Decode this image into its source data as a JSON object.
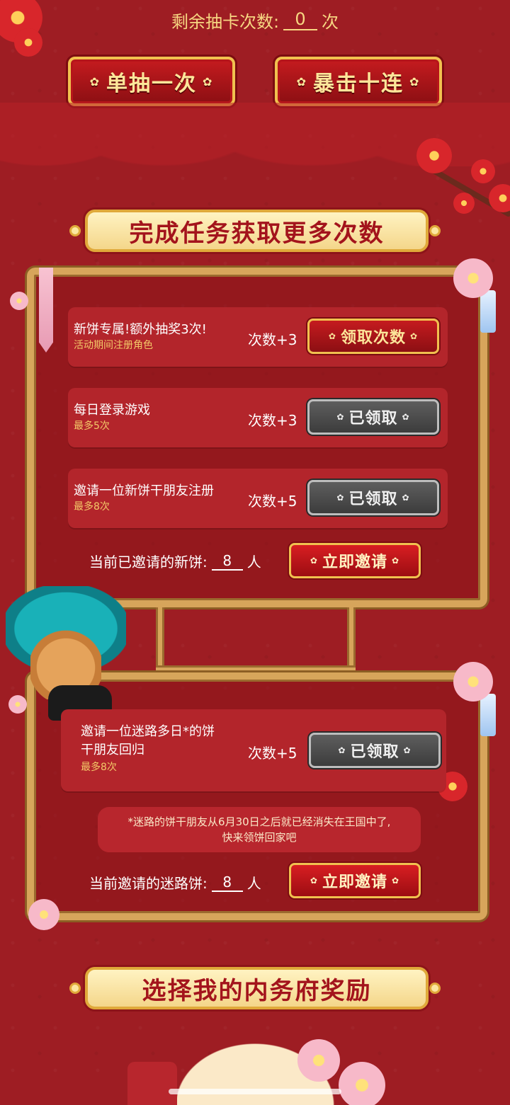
{
  "counter": {
    "label": "剩余抽卡次数:",
    "value": "0",
    "unit": "次"
  },
  "draw_buttons": {
    "single": "单抽一次",
    "ten": "暴击十连"
  },
  "tasks_section": {
    "title": "完成任务获取更多次数",
    "tasks": [
      {
        "title": "新饼专属!额外抽奖3次!",
        "subtitle": "活动期间注册角色",
        "gain": "次数+3",
        "button": "领取次数",
        "state": "active"
      },
      {
        "title": "每日登录游戏",
        "subtitle": "最多5次",
        "gain": "次数+3",
        "button": "已领取",
        "state": "done"
      },
      {
        "title": "邀请一位新饼干朋友注册",
        "subtitle": "最多8次",
        "gain": "次数+5",
        "button": "已领取",
        "state": "done"
      }
    ],
    "invite": {
      "label": "当前已邀请的新饼:",
      "value": "8",
      "unit": "人",
      "button": "立即邀请"
    }
  },
  "return_section": {
    "task": {
      "title_line1": "邀请一位迷路多日*的饼",
      "title_line2": "干朋友回归",
      "subtitle": "最多8次",
      "gain": "次数+5",
      "button": "已领取",
      "state": "done"
    },
    "notice_line1": "*迷路的饼干朋友从6月30日之后就已经消失在王国中了,",
    "notice_line2": "快来领饼回家吧",
    "invite": {
      "label": "当前邀请的迷路饼:",
      "value": "8",
      "unit": "人",
      "button": "立即邀请"
    }
  },
  "rewards_section": {
    "title": "选择我的内务府奖励"
  },
  "colors": {
    "background": "#9e1d23",
    "gold": "#f1c14f",
    "cream": "#fff3c2",
    "disabled": "#4a4a4a"
  },
  "icons": [
    "plum-blossom-icon",
    "cookie-character-icon",
    "tassel-icon",
    "bookmark-tag-icon"
  ]
}
